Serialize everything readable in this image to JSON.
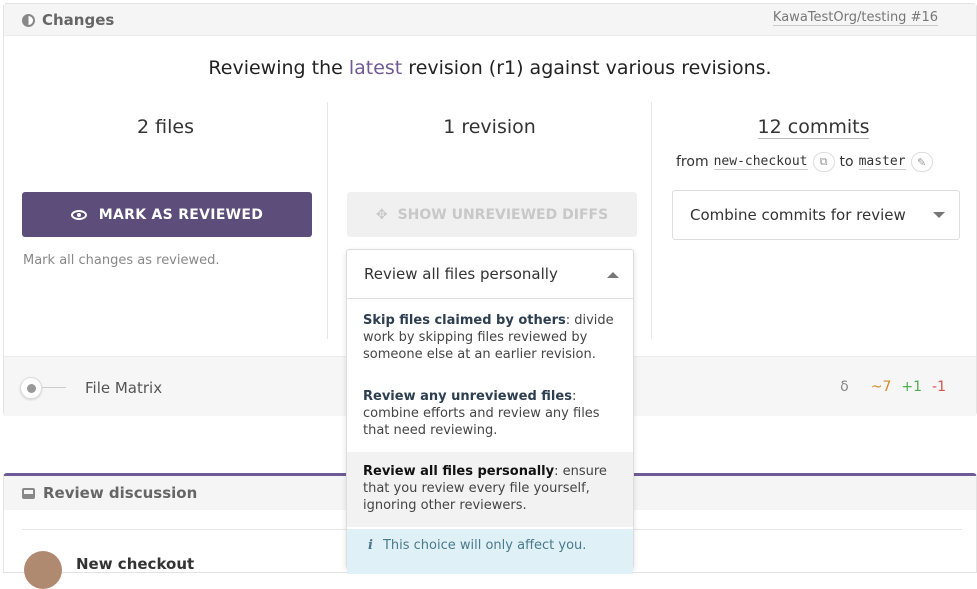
{
  "header": {
    "title": "Changes",
    "repo": "KawaTestOrg/testing #16"
  },
  "headline": {
    "before": "Reviewing the ",
    "highlight": "latest",
    "after": " revision (r1) against various revisions."
  },
  "stats": {
    "files": "2 files",
    "revisions": "1 revision",
    "commits": "12 commits",
    "from_label": "from",
    "from_branch": "new-checkout",
    "to_label": "to",
    "to_branch": "master"
  },
  "actions": {
    "mark_reviewed": "MARK AS REVIEWED",
    "mark_hint": "Mark all changes as reviewed.",
    "show_unreviewed": "SHOW UNREVIEWED DIFFS",
    "combine_select": "Combine commits for review"
  },
  "review_mode": {
    "selected": "Review all files personally",
    "options": [
      {
        "title": "Skip files claimed by others",
        "desc": ": divide work by skipping files reviewed by someone else at an earlier revision."
      },
      {
        "title": "Review any unreviewed files",
        "desc": ": combine efforts and review any files that need reviewing."
      },
      {
        "title": "Review all files personally",
        "desc": ": ensure that you review every file yourself, ignoring other reviewers."
      }
    ],
    "note": "This choice will only affect you."
  },
  "matrix": {
    "label": "File Matrix",
    "delta": "δ",
    "modified": "~7",
    "added": "+1",
    "deleted": "-1"
  },
  "discussion": {
    "title": "Review discussion",
    "first_item": "New checkout"
  }
}
